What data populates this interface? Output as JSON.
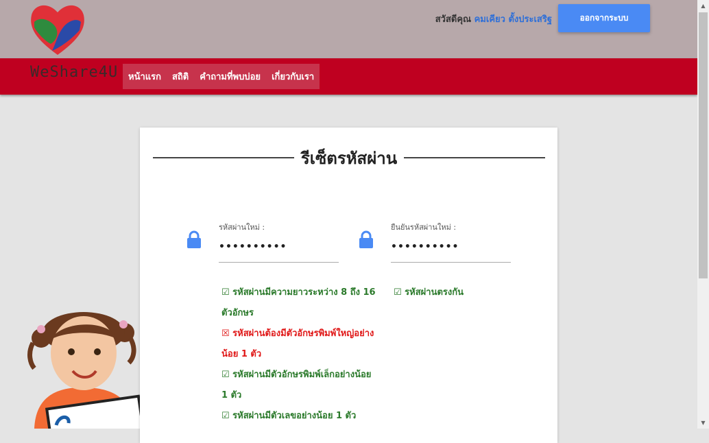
{
  "header": {
    "greeting_prefix": "สวัสดีคุณ",
    "user_name": "คมเคียว ตั้งประเสริฐ",
    "logout_label": "ออกจากระบบ"
  },
  "nav": {
    "brand": "WeShare4U",
    "links": [
      "หน้าแรก",
      "สถิติ",
      "คำถามที่พบบ่อย",
      "เกี่ยวกับเรา"
    ]
  },
  "form": {
    "title": "รีเซ็ตรหัสผ่าน",
    "new_password": {
      "label": "รหัสผ่านใหม่ :",
      "value": "••••••••••"
    },
    "confirm_password": {
      "label": "ยืนยันรหัสผ่านใหม่ :",
      "value": "••••••••••"
    },
    "rules": [
      {
        "text": "☑ รหัสผ่านมีความยาวระหว่าง 8 ถึง 16 ตัวอักษร",
        "status": "ok"
      },
      {
        "text": "☒ รหัสผ่านต้องมีตัวอักษรพิมพ์ใหญ่อย่างน้อย 1 ตัว",
        "status": "bad"
      },
      {
        "text": "☑ รหัสผ่านมีตัวอักษรพิมพ์เล็กอย่างน้อย 1 ตัว",
        "status": "ok"
      },
      {
        "text": "☑ รหัสผ่านมีตัวเลขอย่างน้อย 1 ตัว",
        "status": "ok"
      }
    ],
    "match_rule": {
      "text": "☑ รหัสผ่านตรงกัน",
      "status": "ok"
    }
  },
  "colors": {
    "topbar": "#b7a8aa",
    "navbar": "#bf0020",
    "accent": "#4a8af4",
    "ok": "#2b7a2b",
    "bad": "#e01818"
  },
  "icons": [
    "heart-hands-logo-icon",
    "lock-icon",
    "scroll-up-arrow-icon",
    "scroll-down-arrow-icon"
  ]
}
